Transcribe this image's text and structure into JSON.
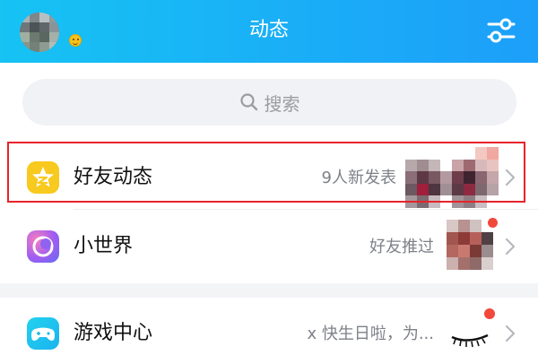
{
  "header": {
    "title": "动态",
    "background": "#1aaef7"
  },
  "search": {
    "placeholder": "搜索"
  },
  "feed": {
    "items": [
      {
        "label": "好友动态",
        "subtitle": "9人新发表",
        "icon": "qzone-star-icon",
        "icon_color": "#f8c91e",
        "highlighted": true
      },
      {
        "label": "小世界",
        "subtitle": "好友推过",
        "icon": "small-world-icon",
        "icon_color": "#7c5cf0",
        "has_red_dot": true
      },
      {
        "label": "游戏中心",
        "subtitle": "x 快生日啦，为...",
        "icon": "gamepad-icon",
        "icon_color": "#21c9e9",
        "has_red_dot": true
      }
    ]
  },
  "colors": {
    "accent": "#1aaef7",
    "highlight": "#e8232b",
    "badge": "#f2473b"
  }
}
